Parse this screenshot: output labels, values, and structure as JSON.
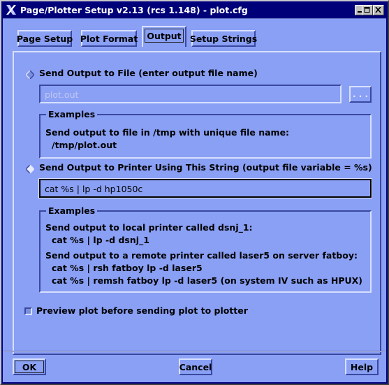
{
  "window": {
    "title": "Page/Plotter Setup v2.13 (rcs 1.148) - plot.cfg",
    "icons": {
      "app": "x-logo-icon",
      "minimize": "minimize-icon",
      "maximize": "maximize-icon",
      "close": "close-icon"
    }
  },
  "tabs": [
    {
      "label": "Page Setup",
      "active": false
    },
    {
      "label": "Plot Format",
      "active": false
    },
    {
      "label": "Output",
      "active": true
    },
    {
      "label": "Setup Strings",
      "active": false
    }
  ],
  "file_output": {
    "radio_label": "Send Output to File (enter output file name)",
    "selected": false,
    "value": "plot.out",
    "browse_label": ". . .",
    "examples": {
      "title": "Examples",
      "lines": [
        "Send output to file in /tmp with unique file name:",
        "/tmp/plot.out"
      ]
    }
  },
  "printer_output": {
    "radio_label": "Send Output to Printer Using This String (output file variable = %s)",
    "selected": true,
    "value": "cat %s | lp -d hp1050c",
    "examples": {
      "title": "Examples",
      "lines": [
        "Send output to local printer called dsnj_1:",
        "cat %s | lp -d dsnj_1",
        "Send output to a remote printer called laser5 on server fatboy:",
        "cat %s | rsh fatboy lp -d laser5",
        "cat %s | remsh fatboy lp -d laser5  (on system IV such as HPUX)"
      ]
    }
  },
  "preview": {
    "label": "Preview plot before sending plot to plotter",
    "checked": false
  },
  "buttons": {
    "ok": "OK",
    "cancel": "Cancel",
    "help": "Help"
  }
}
